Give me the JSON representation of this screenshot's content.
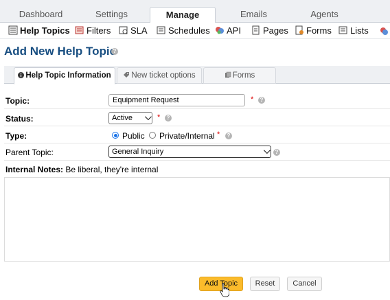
{
  "top_nav": {
    "tabs": [
      {
        "label": "Dashboard"
      },
      {
        "label": "Settings"
      },
      {
        "label": "Manage",
        "active": true
      },
      {
        "label": "Emails"
      },
      {
        "label": "Agents"
      }
    ]
  },
  "sub_nav": {
    "items": [
      {
        "label": "Help Topics",
        "icon": "help-topics-icon",
        "active": true
      },
      {
        "label": "Filters",
        "icon": "filters-icon"
      },
      {
        "label": "SLA",
        "icon": "sla-icon"
      },
      {
        "label": "Schedules",
        "icon": "schedules-icon"
      },
      {
        "label": "API",
        "icon": "api-icon"
      },
      {
        "label": "Pages",
        "icon": "pages-icon"
      },
      {
        "label": "Forms",
        "icon": "forms-icon"
      },
      {
        "label": "Lists",
        "icon": "lists-icon"
      }
    ]
  },
  "page": {
    "title": "Add New Help Topic"
  },
  "content_tabs": [
    {
      "label": "Help Topic Information",
      "icon": "info-icon",
      "active": true
    },
    {
      "label": "New ticket options",
      "icon": "tag-icon"
    },
    {
      "label": "Forms",
      "icon": "forms-icon"
    }
  ],
  "form": {
    "topic": {
      "label": "Topic:",
      "value": "Equipment Request",
      "required": "*"
    },
    "status": {
      "label": "Status:",
      "value": "Active",
      "required": "*"
    },
    "type": {
      "label": "Type:",
      "options": [
        "Public",
        "Private/Internal"
      ],
      "selected": "Public",
      "required": "*"
    },
    "parent_topic": {
      "label": "Parent Topic:",
      "value": "General Inquiry"
    },
    "internal_notes": {
      "label": "Internal Notes:",
      "hint": "Be liberal, they're internal"
    }
  },
  "buttons": {
    "add": "Add Topic",
    "reset": "Reset",
    "cancel": "Cancel"
  },
  "colors": {
    "title": "#184e81",
    "primary_button": "#fbbb2b",
    "required": "#dd0000"
  }
}
